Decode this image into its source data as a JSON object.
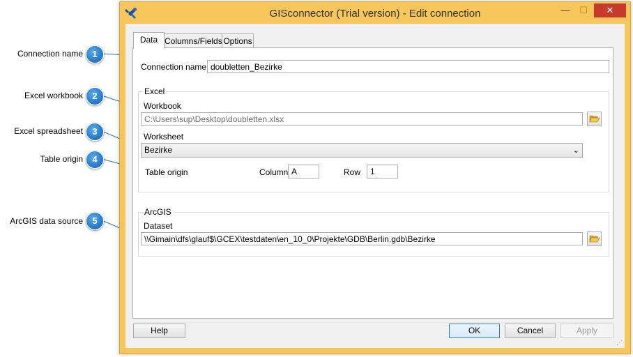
{
  "window": {
    "title": "GISconnector (Trial version) - Edit connection",
    "minimize_glyph": "—",
    "maximize_glyph": "☐",
    "close_glyph": "✕"
  },
  "tabs": [
    {
      "label": "Data",
      "active": true
    },
    {
      "label": "Columns/Fields",
      "active": false
    },
    {
      "label": "Options",
      "active": false
    }
  ],
  "data_tab": {
    "connection_name_label": "Connection name",
    "connection_name_value": "doubletten_Bezirke",
    "excel": {
      "group_title": "Excel",
      "workbook_label": "Workbook",
      "workbook_path": "C:\\Users\\sup\\Desktop\\doubletten.xlsx",
      "worksheet_label": "Worksheet",
      "worksheet_value": "Bezirke",
      "table_origin_label": "Table origin",
      "column_label": "Column",
      "column_value": "A",
      "row_label": "Row",
      "row_value": "1"
    },
    "arcgis": {
      "group_title": "ArcGIS",
      "dataset_label": "Dataset",
      "dataset_path": "\\\\Gimain\\dfs\\glauf$\\GCEX\\testdaten\\en_10_0\\Projekte\\GDB\\Berlin.gdb\\Bezirke"
    }
  },
  "buttons": {
    "help": "Help",
    "ok": "OK",
    "cancel": "Cancel",
    "apply": "Apply"
  },
  "callouts": [
    {
      "number": "1",
      "label": "Connection name"
    },
    {
      "number": "2",
      "label": "Excel workbook"
    },
    {
      "number": "3",
      "label": "Excel spreadsheet"
    },
    {
      "number": "4",
      "label": "Table origin"
    },
    {
      "number": "5",
      "label": "ArcGIS data source"
    }
  ],
  "icons": {
    "app": "tools-icon",
    "browse": "folder-open-icon",
    "combo": "chevron-down-icon"
  },
  "colors": {
    "window_frame": "#f6c65a",
    "close_button": "#c7392b",
    "callout_badge": "#2b7fcf"
  }
}
